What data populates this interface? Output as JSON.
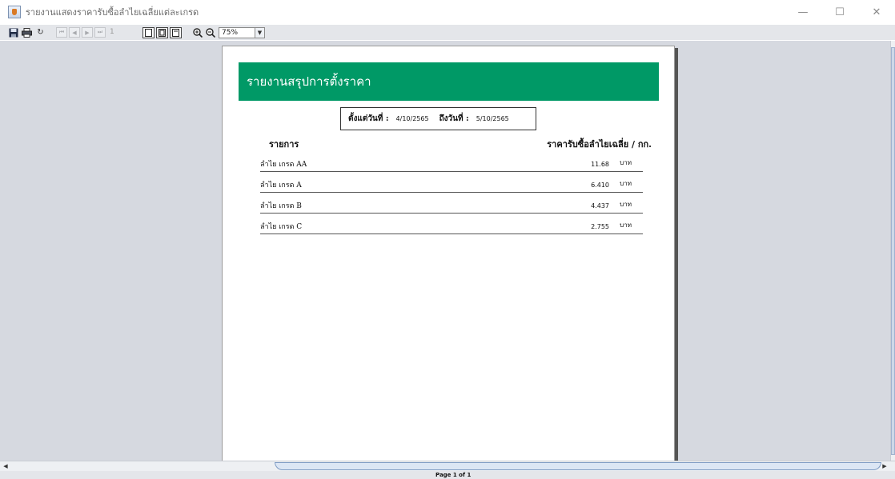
{
  "window": {
    "title": "รายงานแสดงราคารับซื้อลำไยเฉลี่ยแต่ละเกรด",
    "controls": [
      "—",
      "☐",
      "✕"
    ]
  },
  "toolbar": {
    "save": "save-icon",
    "print": "print-icon",
    "reload": "↻",
    "first": "⏮",
    "prev": "◀",
    "next": "▶",
    "last": "⏭",
    "page_number": "1",
    "zoom_value": "75%"
  },
  "report": {
    "header": "รายงานสรุปการตั้งราคา",
    "from_label": "ตั้งแต่วันที่ :",
    "from_date": "4/10/2565",
    "to_label": "ถึงวันที่ :",
    "to_date": "5/10/2565",
    "col_item": "รายการ",
    "col_price": "ราคารับซื้อลำไยเฉลี่ย / กก.",
    "rows": [
      {
        "name": "ลำไย เกรด AA",
        "price": "11.68",
        "unit": "บาท"
      },
      {
        "name": "ลำไย เกรด A",
        "price": "6.410",
        "unit": "บาท"
      },
      {
        "name": "ลำไย เกรด B",
        "price": "4.437",
        "unit": "บาท"
      },
      {
        "name": "ลำไย เกรด C",
        "price": "2.755",
        "unit": "บาท"
      }
    ]
  },
  "status": {
    "page_info": "Page 1 of 1"
  },
  "colors": {
    "banner": "#009966",
    "viewport": "#d6d9e0"
  }
}
